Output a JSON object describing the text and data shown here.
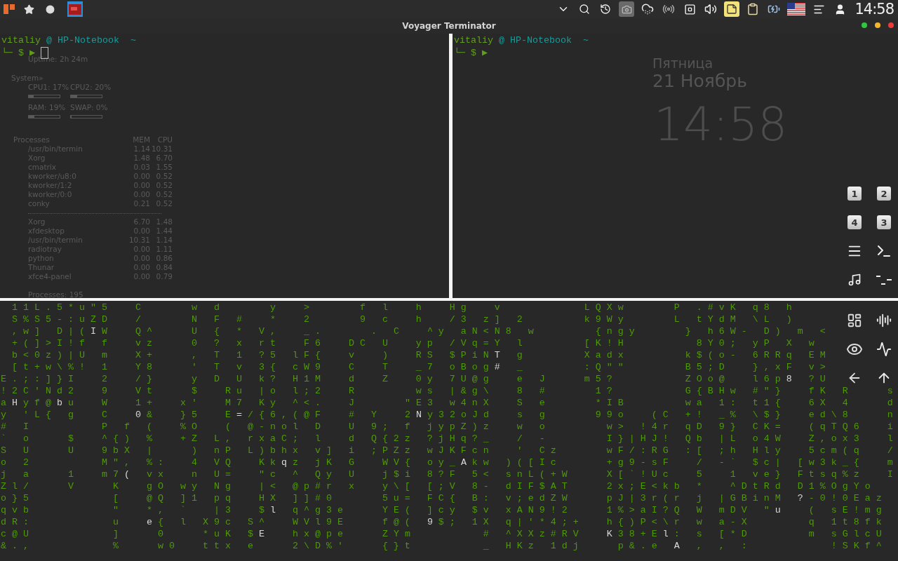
{
  "top_panel": {
    "clock": "14:58"
  },
  "window": {
    "title": "Voyager Terminator"
  },
  "desktop": {
    "conky": {
      "uptime": "Uptime: 2h 24m",
      "system_heading": "System»",
      "meters": [
        {
          "label": "CPU1: 17%",
          "level": 0.17
        },
        {
          "label": "CPU2: 20%",
          "level": 0.2
        },
        {
          "label": "RAM: 19%",
          "level": 0.19
        },
        {
          "label": "SWAP: 0%",
          "level": 0
        }
      ],
      "processes_heading": "Processes",
      "columns": [
        "MEM",
        "CPU"
      ],
      "top_cpu": [
        {
          "name": "/usr/bin/termin",
          "mem": "1.14",
          "cpu": "10.31"
        },
        {
          "name": "Xorg",
          "mem": "1.48",
          "cpu": "6.70"
        },
        {
          "name": "cmatrix",
          "mem": "0.03",
          "cpu": "1.55"
        },
        {
          "name": "kworker/u8:0",
          "mem": "0.00",
          "cpu": "0.52"
        },
        {
          "name": "kworker/1:2",
          "mem": "0.00",
          "cpu": "0.52"
        },
        {
          "name": "kworker/0:0",
          "mem": "0.00",
          "cpu": "0.52"
        },
        {
          "name": "conky",
          "mem": "0.21",
          "cpu": "0.52"
        }
      ],
      "top_mem": [
        {
          "name": "Xorg",
          "mem": "6.70",
          "cpu": "1.48"
        },
        {
          "name": "xfdesktop",
          "mem": "0.00",
          "cpu": "1.44"
        },
        {
          "name": "/usr/bin/termin",
          "mem": "10.31",
          "cpu": "1.14"
        },
        {
          "name": "radiotray",
          "mem": "0.00",
          "cpu": "1.11"
        },
        {
          "name": "python",
          "mem": "0.00",
          "cpu": "0.86"
        },
        {
          "name": "Thunar",
          "mem": "0.00",
          "cpu": "0.84"
        },
        {
          "name": "xfce4-panel",
          "mem": "0.00",
          "cpu": "0.79"
        }
      ],
      "total": "Processes: 195"
    },
    "clock_widget": {
      "day": "Пятница",
      "date": "21 Ноябрь",
      "time": "14:58"
    },
    "workspaces": [
      "1",
      "2",
      "4",
      "3"
    ]
  },
  "terminals": [
    {
      "user": "vitaliy",
      "host": "@ HP-Notebook  ~",
      "prompt": "└─ $ ▶",
      "cursor": true
    },
    {
      "user": "vitaliy",
      "host": "@ HP-Notebook  ~",
      "prompt": "└─ $ ▶",
      "cursor": false
    }
  ],
  "matrix": {
    "rows": [
      {
        "segments": [
          {
            "text": "  1 1 L . 5 * u \" 5     C         w   d         y     >         f   l     h     H g     v               L Q X w         P   . # v K   q 8   h",
            "bright": false
          }
        ]
      },
      {
        "segments": [
          {
            "text": "  S % S 5 - : u Z D     /         N   F   #     *     2         9   c     h     / 3   z ]   2           k 9 W y         L   t Y d M   \\ L   )",
            "bright": false
          }
        ]
      },
      {
        "segments": [
          {
            "text": "  , w ]   D | ( ",
            "bright": false
          },
          {
            "text": "I",
            "bright": true
          },
          {
            "text": " W     Q ^       U   {   *   V ,     _ .         .   C     ^ y   a N < N 8   w           { n g y         }   h 6 W -   D )   m   <",
            "bright": false
          }
        ]
      },
      {
        "segments": [
          {
            "text": "  + ( ] > I ! f   f     v z       0   ?   x   r t     F 6     D C   U     y p   / V q = Y   l           [ K ! H             8 Y 0 ;   y P   X   w",
            "bright": false
          }
        ]
      },
      {
        "segments": [
          {
            "text": "  b < 0 z ) | U   m     X +       ,   T   1   ? 5   l F {     v     )     R S   $ P i N ",
            "bright": false
          },
          {
            "text": "T",
            "bright": true
          },
          {
            "text": "   g           X a d x           k $ ( o -   6 R R q   E M",
            "bright": false
          }
        ]
      },
      {
        "segments": [
          {
            "text": "  [ t + w \\ % !   1     Y 8       '   T   v   3 {   c W 9     C     T     _ 7   o B o g ",
            "bright": false
          },
          {
            "text": "#",
            "bright": true
          },
          {
            "text": "   _           : Q \" \"           B 5 ; D     } , x F   v >",
            "bright": false
          }
        ]
      },
      {
        "segments": [
          {
            "text": "E . ; : ] } I     2     / }       y   D   U   k ?   H 1 M     d     Z     0 y   7 U @ g     e   J       m 5 ?             Z O o @     l 6 p ",
            "bright": false
          },
          {
            "text": "8",
            "bright": true
          },
          {
            "text": "   ? U",
            "bright": false
          }
        ]
      },
      {
        "segments": [
          {
            "text": "! 2 C ' N d 2     9     V t       $     R u   | o   l ; 2     R           w s   | & g \\     8   #         1 ?             G { B H w   # \" }     f K   R       s",
            "bright": false
          }
        ]
      },
      {
        "segments": [
          {
            "text": "a ",
            "bright": false
          },
          {
            "text": "H",
            "bright": true
          },
          {
            "text": " y f @ ",
            "bright": false
          },
          {
            "text": "b",
            "bright": true
          },
          {
            "text": " u     W     1 +     x '     M 7   K y   ^ < .     J         \" E 3   w 4 n X     S   e         * I B           w a   1 :   t 1 {     6 X   4       d",
            "bright": false
          }
        ]
      },
      {
        "segments": [
          {
            "text": "y   ' L {   g     C     ",
            "bright": false
          },
          {
            "text": "0",
            "bright": true
          },
          {
            "text": " &     } 5     E ",
            "bright": false
          },
          {
            "text": "=",
            "bright": true
          },
          {
            "text": " / { 6 , ( @ F     #   Y     2 ",
            "bright": false
          },
          {
            "text": "N",
            "bright": true
          },
          {
            "text": " y 3 2 o J d     s   g         9 9 o     ( C   + !   _ %   \\ $ }     e d \\ 8       n",
            "bright": false
          }
        ]
      },
      {
        "segments": [
          {
            "text": "#   I             P   f   (     % O     (   @ - n o l   D     U   9 ;   f   j y p Z ) z     w   o           w >   ! 4 r   q D   9 }   C K =     ( q T Q 6     i",
            "bright": false
          }
        ]
      },
      {
        "segments": [
          {
            "text": "`   o       $     ^ { )   %     + Z   L ,   r x a C ;   l     d   Q { 2 z   ? j H q ? _     /   -           I } | H J !   Q b   | L   o 4 W     Z , o x 3     l",
            "bright": false
          }
        ]
      },
      {
        "segments": [
          {
            "text": "S   U       U     9 b X   |       )   n P   L ) b h x   v ]   i   ; P Z z   w J K F c n     '   C z         w F / : R G   : [   ; h   H l y     5 c m ( q     /",
            "bright": false
          }
        ]
      },
      {
        "segments": [
          {
            "text": "o   2             M \" ,   % :     4   V Q     K k ",
            "bright": false
          },
          {
            "text": "q",
            "bright": true
          },
          {
            "text": " z   j K   G     W V {   o y _ ",
            "bright": false
          },
          {
            "text": "A",
            "bright": true
          },
          {
            "text": " k w   ) ( [ I c         + g 9 - s F     /   - `   $ c |   [ w 3 k _ {     m",
            "bright": false
          }
        ]
      },
      {
        "segments": [
          {
            "text": "j   a       1     m 7 ",
            "bright": false
          },
          {
            "text": "(",
            "bright": true
          },
          {
            "text": "   v x     n   U =     \" c   ^   Q y   U     j $ i   8 ? F   5 <   s n L ( + W       X [ ` ! U c     5     1   v e }   F t s q % z     I",
            "bright": false
          }
        ]
      },
      {
        "segments": [
          {
            "text": "Z l /       V       K     g O   w y   N g     | <   @ p # r   x     y \\ [   [ ; V   8 -   d I F $ A T       2 x ; E < k b   *     ^ D t R d   D 1 % O g Y o",
            "bright": false
          }
        ]
      },
      {
        "segments": [
          {
            "text": "o } 5               [     @ Q   ] 1   p q     H X   ] ] # 0         5 u =   F C {   B :   v ; e d Z W       p J | 3 r ( r   j   | G B i n M   ",
            "bright": false
          },
          {
            "text": "?",
            "bright": true
          },
          {
            "text": " - 0 ! 0 E a z",
            "bright": false
          }
        ]
      },
      {
        "segments": [
          {
            "text": "q v b               \"     * ,   `     | 3     $ ",
            "bright": false
          },
          {
            "text": "l",
            "bright": true
          },
          {
            "text": "   q ^ g 3 e       Y E (   ] c y   $ v   x A N 9 ! 2       1 % > a I ? Q   W   m D V   \" ",
            "bright": false
          },
          {
            "text": "u",
            "bright": true
          },
          {
            "text": "     (   s E ! m g",
            "bright": false
          }
        ]
      },
      {
        "segments": [
          {
            "text": "d R :               u     ",
            "bright": false
          },
          {
            "text": "e",
            "bright": true
          },
          {
            "text": " {   l   X 9 c   S ^     W V l 9 E       f @ (   ",
            "bright": false
          },
          {
            "text": "9",
            "bright": true
          },
          {
            "text": " $ ;   1 X   q | ' * 4 ; +     h { ) P < \\ r   w   a - X           q   1 t 8 f k",
            "bright": false
          }
        ]
      },
      {
        "segments": [
          {
            "text": "c @ U               ]       0       * u K   $ ",
            "bright": false
          },
          {
            "text": "E",
            "bright": true
          },
          {
            "text": "     h x @ p e       Z Y m             #   ^ X X z # R V     ",
            "bright": false
          },
          {
            "text": "K",
            "bright": true
          },
          {
            "text": " 3 8 + E ",
            "bright": false
          },
          {
            "text": "l",
            "bright": true
          },
          {
            "text": " :   s   [ * D           m   s G l c U",
            "bright": false
          }
        ]
      },
      {
        "segments": [
          {
            "text": "& . ,               %       w 0     t t x   e       2 \\ D % '       { } t             _   H K z   1 d j       p & . e   ",
            "bright": false
          },
          {
            "text": "A",
            "bright": true
          },
          {
            "text": "   ,   ,   :               ! S K f ^",
            "bright": false
          }
        ]
      }
    ]
  }
}
